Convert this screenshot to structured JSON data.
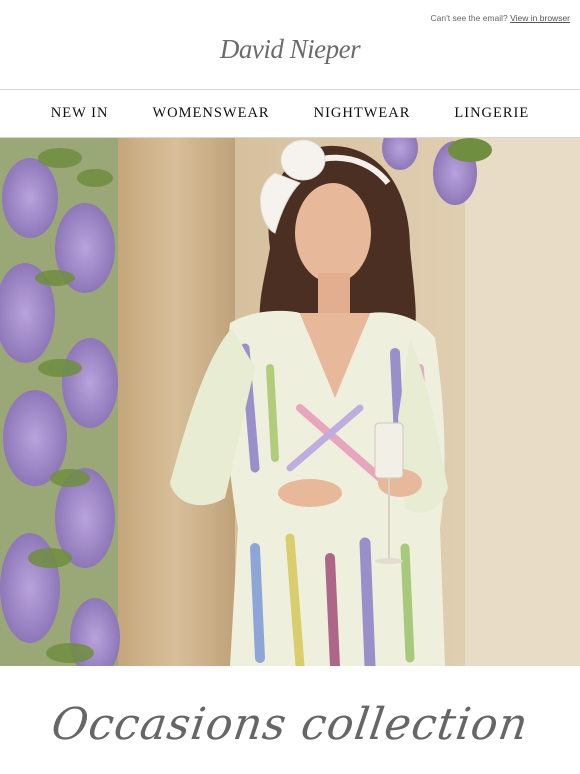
{
  "preheader": {
    "text": "Can't see the email?",
    "link_label": "View in browser"
  },
  "brand": {
    "logo_text": "David Nieper"
  },
  "nav": {
    "items": [
      {
        "label": "NEW IN"
      },
      {
        "label": "WOMENSWEAR"
      },
      {
        "label": "NIGHTWEAR"
      },
      {
        "label": "LINGERIE"
      }
    ]
  },
  "hero": {
    "colors": {
      "wall": "#d9c4a3",
      "pillar": "#cdb590",
      "wisteria": "#a48cc8",
      "foliage": "#7e9b55",
      "hair": "#4a2f22",
      "skin": "#e8b89a"
    }
  },
  "headline": {
    "text": "Occasions collection"
  }
}
